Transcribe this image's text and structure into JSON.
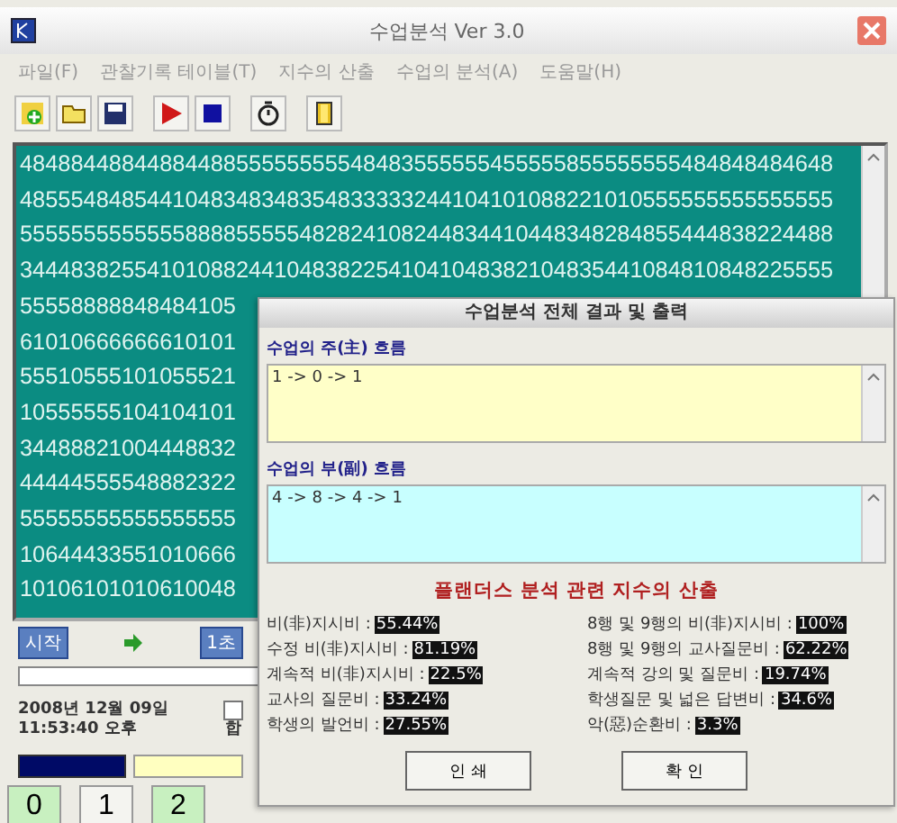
{
  "window": {
    "title": "수업분석 Ver 3.0"
  },
  "menu": [
    "파일(F)",
    "관찰기록 테이블(T)",
    "지수의 산출",
    "수업의 분석(A)",
    "도움말(H)"
  ],
  "toolbar": [
    {
      "kind": "new"
    },
    {
      "kind": "open"
    },
    {
      "kind": "save"
    },
    {
      "kind": "play"
    },
    {
      "kind": "stop"
    },
    {
      "kind": "timer"
    },
    {
      "kind": "exit"
    }
  ],
  "code_rows": [
    "4848844884488448855555555548483555555455555855555555484848484648",
    "4855548485441048348348354833333244104101088221010555555555555555",
    "5555555555555888855555482824108244834410448348284855444838224488",
    "3444838255410108824410483822541041048382104835441084810848225555",
    "55558888848484105",
    "61010666666610101",
    "55510555101055521",
    "10555555104104101",
    "34488821004448832",
    "44444555548882322",
    "55555555555555555",
    "10644433551010666",
    "10106101010610048"
  ],
  "controls": {
    "start_button": "시작",
    "interval": "1초",
    "date": "2008년 12월 09일",
    "time": "11:53:40 오후",
    "checkbox": {
      "checked": false
    },
    "checkbox_label": "합"
  },
  "number_buttons": [
    {
      "label": "0",
      "highlighted": true
    },
    {
      "label": "1",
      "highlighted": false
    },
    {
      "label": "2",
      "highlighted": true
    }
  ],
  "dialog": {
    "title": "수업분석 전체 결과 및 출력",
    "main_flow": {
      "label": "수업의 주(主) 흐름",
      "value": "1 -> 0 -> 1"
    },
    "sub_flow": {
      "label": "수업의 부(副) 흐름",
      "value": "4 -> 8 -> 4 -> 1"
    },
    "heading": "플랜더스 분석 관련 지수의 산출",
    "stats_left": [
      {
        "label": "비(非)지시비 :",
        "value": "55.44%"
      },
      {
        "label": "수정 비(非)지시비 :",
        "value": "81.19%"
      },
      {
        "label": "계속적 비(非)지시비 :",
        "value": "22.5%"
      },
      {
        "label": "교사의 질문비 :",
        "value": "33.24%"
      },
      {
        "label": "학생의 발언비 :",
        "value": "27.55%"
      }
    ],
    "stats_right": [
      {
        "label": "8행 및 9행의 비(非)지시비 :",
        "value": "100%"
      },
      {
        "label": "8행 및 9행의 교사질문비 :",
        "value": "62.22%"
      },
      {
        "label": "계속적 강의 및 질문비 :",
        "value": "19.74%"
      },
      {
        "label": "학생질문 및 넓은 답변비 :",
        "value": "34.6%"
      },
      {
        "label": "악(惡)순환비 :",
        "value": "3.3%"
      }
    ],
    "buttons": [
      "인 쇄",
      "확 인"
    ]
  }
}
